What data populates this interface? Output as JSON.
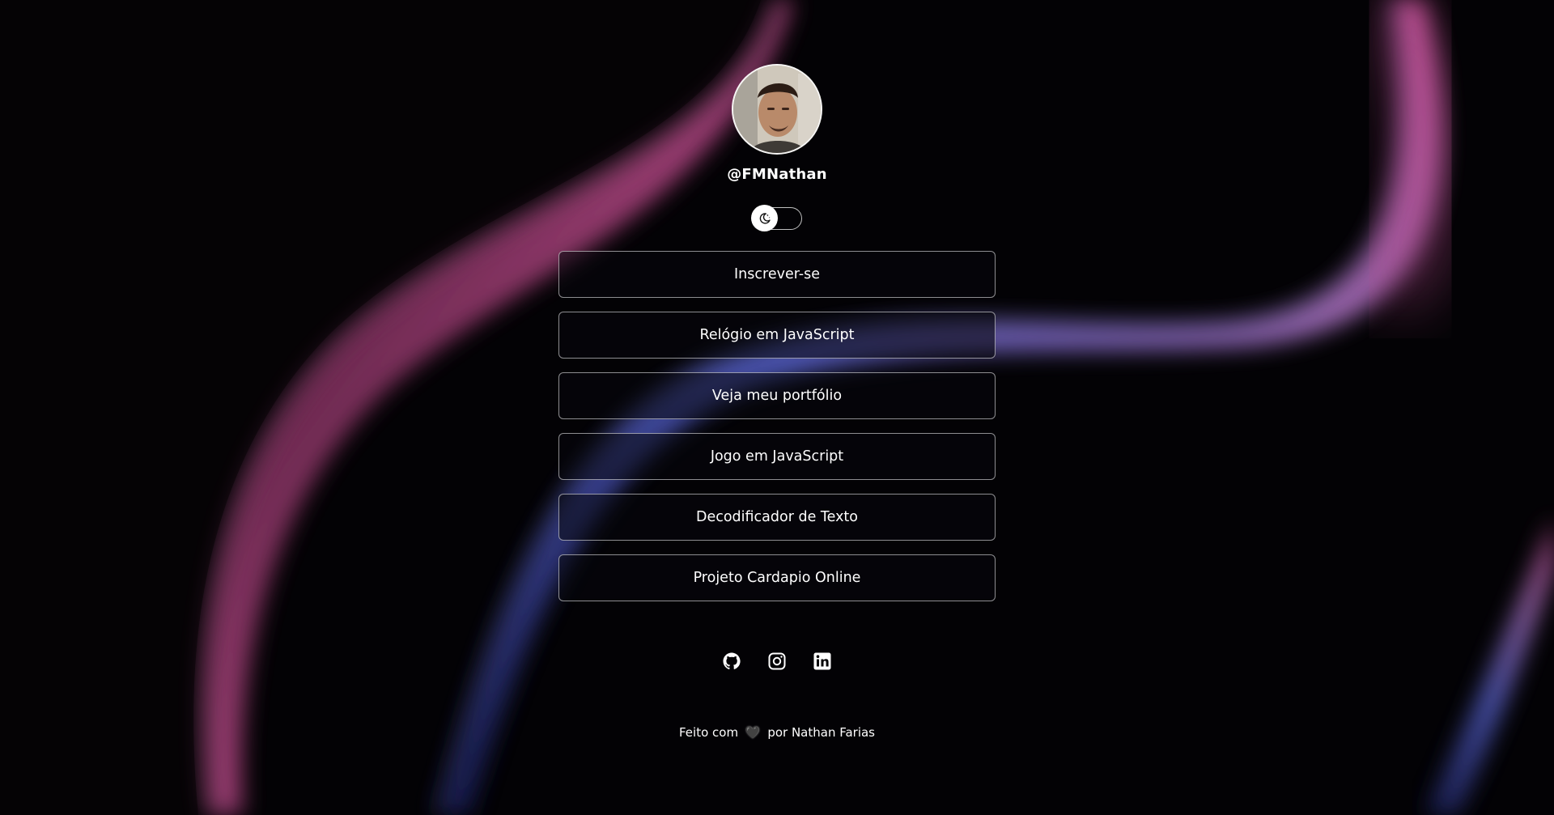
{
  "profile": {
    "username": "@FMNathan",
    "avatar_alt": "avatar"
  },
  "theme_toggle": {
    "icon": "moon-stars-icon",
    "state": "dark"
  },
  "links": [
    {
      "label": "Inscrever-se"
    },
    {
      "label": "Relógio em JavaScript"
    },
    {
      "label": "Veja meu portfólio"
    },
    {
      "label": "Jogo em JavaScript"
    },
    {
      "label": "Decodificador de Texto"
    },
    {
      "label": "Projeto Cardapio Online"
    }
  ],
  "socials": [
    {
      "icon": "github-icon"
    },
    {
      "icon": "instagram-icon"
    },
    {
      "icon": "linkedin-icon"
    }
  ],
  "footer": {
    "prefix": "Feito com",
    "heart": "🖤",
    "suffix": "por Nathan Farias"
  },
  "colors": {
    "background": "#050406",
    "text": "#ffffff",
    "wave_pink": "#d4559a",
    "wave_blue": "#4a5cc8"
  }
}
